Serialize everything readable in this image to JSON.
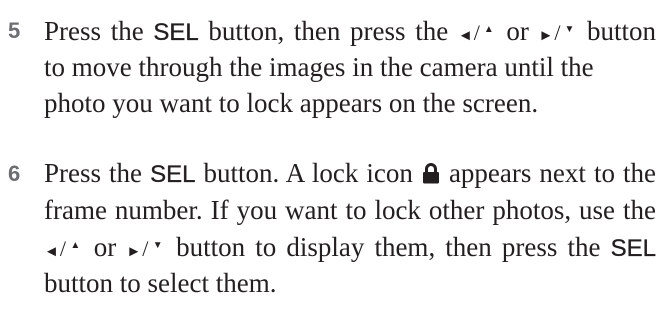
{
  "colors": {
    "text": "#231f20",
    "step_number": "#6d6e71",
    "background": "#ffffff"
  },
  "icons": {
    "lock": "lock-icon",
    "left": "left-arrow-icon",
    "up": "up-arrow-icon",
    "right": "right-arrow-icon",
    "down": "down-arrow-icon"
  },
  "labels": {
    "sel": "SEL"
  },
  "symbols": {
    "left": "◄",
    "up": "▲",
    "right": "►",
    "down": "▼",
    "slash": "/"
  },
  "steps": [
    {
      "number": "5",
      "lines": [
        [
          "Press the ",
          " button, then press the ",
          " or ",
          " button"
        ],
        [
          "to move through the images in the camera until the"
        ],
        [
          "photo you want to lock appears on the screen."
        ]
      ]
    },
    {
      "number": "6",
      "lines": [
        [
          "Press the ",
          " button. A lock icon ",
          " appears next to the"
        ],
        [
          "frame number. If you want to lock other photos, use the"
        ],
        [
          " or ",
          " button to display them, then press the "
        ],
        [
          "button to select them."
        ]
      ]
    }
  ]
}
